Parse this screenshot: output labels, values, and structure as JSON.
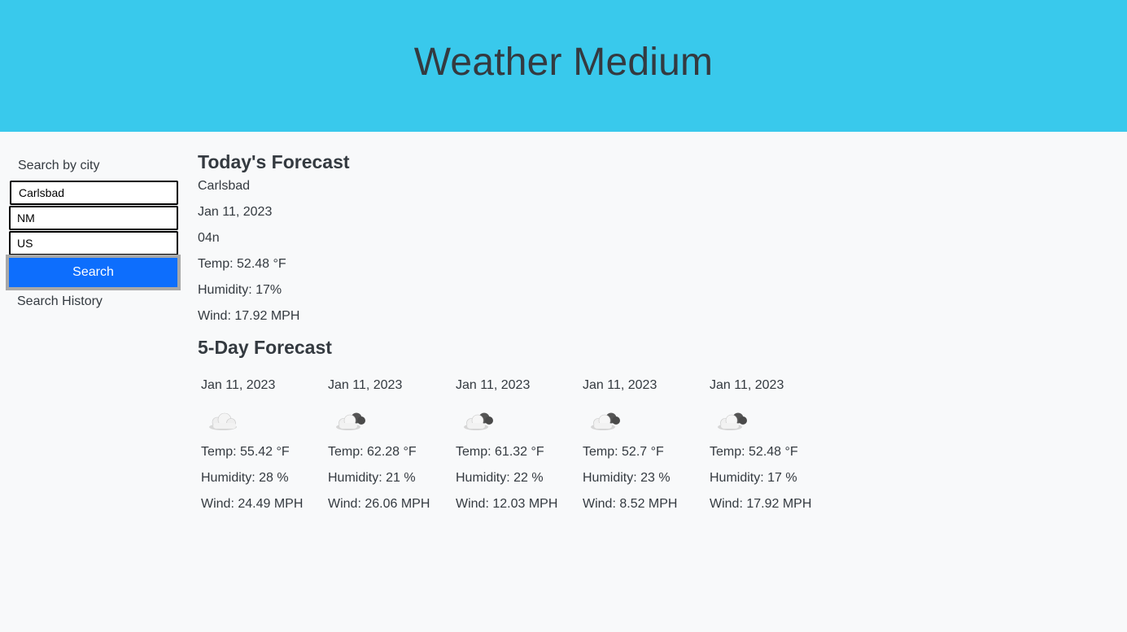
{
  "header": {
    "title": "Weather Medium"
  },
  "sidebar": {
    "search_label": "Search by city",
    "city_value": "Carlsbad",
    "state_value": "NM",
    "country_value": "US",
    "search_button": "Search",
    "history_label": "Search History"
  },
  "today": {
    "title": "Today's Forecast",
    "city": "Carlsbad",
    "date": "Jan 11, 2023",
    "icon_code": "04n",
    "temp": "Temp: 52.48 °F",
    "humidity": "Humidity: 17%",
    "wind": "Wind: 17.92 MPH"
  },
  "five_day": {
    "title": "5-Day Forecast",
    "days": [
      {
        "date": "Jan 11, 2023",
        "icon": "cloud-icon",
        "temp": "Temp: 55.42 °F",
        "humidity": "Humidity: 28 %",
        "wind": "Wind: 24.49 MPH"
      },
      {
        "date": "Jan 11, 2023",
        "icon": "broken-clouds-icon",
        "temp": "Temp: 62.28 °F",
        "humidity": "Humidity: 21 %",
        "wind": "Wind: 26.06 MPH"
      },
      {
        "date": "Jan 11, 2023",
        "icon": "broken-clouds-icon",
        "temp": "Temp: 61.32 °F",
        "humidity": "Humidity: 22 %",
        "wind": "Wind: 12.03 MPH"
      },
      {
        "date": "Jan 11, 2023",
        "icon": "broken-clouds-icon",
        "temp": "Temp: 52.7 °F",
        "humidity": "Humidity: 23 %",
        "wind": "Wind: 8.52 MPH"
      },
      {
        "date": "Jan 11, 2023",
        "icon": "broken-clouds-icon",
        "temp": "Temp: 52.48 °F",
        "humidity": "Humidity: 17 %",
        "wind": "Wind: 17.92 MPH"
      }
    ]
  },
  "colors": {
    "header_bg": "#39c9ec",
    "page_bg": "#f8f9fa",
    "button_bg": "#0d6efd",
    "text": "#343a40"
  }
}
